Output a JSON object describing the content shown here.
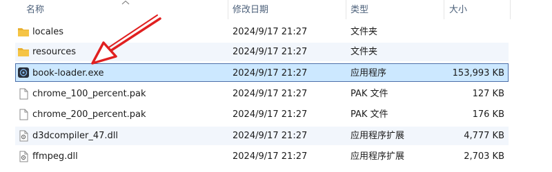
{
  "columns": {
    "name": "名称",
    "date": "修改日期",
    "type": "类型",
    "size": "大小"
  },
  "files": [
    {
      "name": "locales",
      "date": "2024/9/17 21:27",
      "type": "文件夹",
      "size": "",
      "icon": "folder-icon",
      "selected": false
    },
    {
      "name": "resources",
      "date": "2024/9/17 21:27",
      "type": "文件夹",
      "size": "",
      "icon": "folder-icon",
      "selected": false
    },
    {
      "name": "book-loader.exe",
      "date": "2024/9/17 21:27",
      "type": "应用程序",
      "size": "153,993 KB",
      "icon": "exe-icon",
      "selected": true
    },
    {
      "name": "chrome_100_percent.pak",
      "date": "2024/9/17 21:27",
      "type": "PAK 文件",
      "size": "127 KB",
      "icon": "file-icon",
      "selected": false
    },
    {
      "name": "chrome_200_percent.pak",
      "date": "2024/9/17 21:27",
      "type": "PAK 文件",
      "size": "176 KB",
      "icon": "file-icon",
      "selected": false
    },
    {
      "name": "d3dcompiler_47.dll",
      "date": "2024/9/17 21:27",
      "type": "应用程序扩展",
      "size": "4,777 KB",
      "icon": "dll-icon",
      "selected": false
    },
    {
      "name": "ffmpeg.dll",
      "date": "2024/9/17 21:27",
      "type": "应用程序扩展",
      "size": "2,703 KB",
      "icon": "dll-icon",
      "selected": false
    }
  ],
  "colors": {
    "selection_bg": "#cce8ff",
    "selection_border": "#4b6ea8",
    "alt_row_bg": "#f2f6fc",
    "header_text": "#4c607a",
    "annotation_arrow": "#e02020",
    "folder_yellow": "#f5c445"
  }
}
